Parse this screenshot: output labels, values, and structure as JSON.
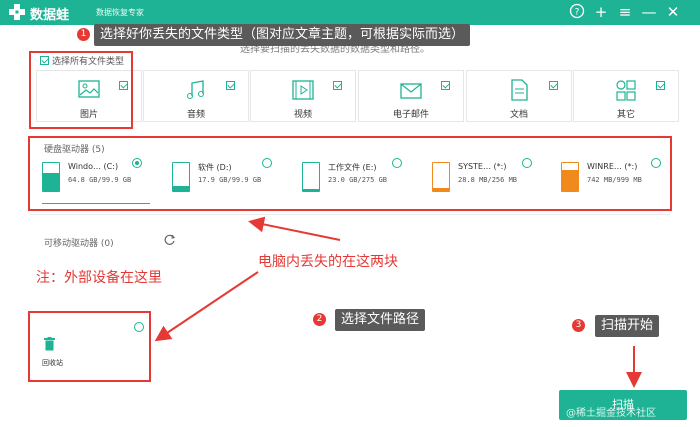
{
  "app": {
    "name": "数据蛙",
    "subtitle": "数据恢复专家"
  },
  "window_controls": {
    "help": "?",
    "add": "+",
    "menu": "≡",
    "minimize": "—",
    "close": "✕"
  },
  "callouts": {
    "step1": {
      "num": "1",
      "text": "选择好你丢失的文件类型（图对应文章主题，可根据实际而选）"
    },
    "step2": {
      "num": "2",
      "text": "选择文件路径"
    },
    "step3": {
      "num": "3",
      "text": "扫描开始"
    }
  },
  "file_types": {
    "header_faded": "选择要扫描的丢失数据的数据类型和路径。",
    "select_all": "选择所有文件类型",
    "items": [
      {
        "label": "图片",
        "icon": "image-icon"
      },
      {
        "label": "音频",
        "icon": "music-icon"
      },
      {
        "label": "视频",
        "icon": "video-icon"
      },
      {
        "label": "电子邮件",
        "icon": "email-icon"
      },
      {
        "label": "文档",
        "icon": "document-icon"
      },
      {
        "label": "其它",
        "icon": "other-icon"
      }
    ]
  },
  "hard_drives": {
    "label": "硬盘驱动器 (5)",
    "items": [
      {
        "name": "Windo… (C:)",
        "size": "64.8 GB/99.9 GB",
        "used": 0.65,
        "color": "#1db394",
        "selected": true
      },
      {
        "name": "软件 (D:)",
        "size": "17.9 GB/99.9 GB",
        "used": 0.18,
        "color": "#1db394",
        "selected": false
      },
      {
        "name": "工作文件 (E:)",
        "size": "23.0 GB/275 GB",
        "used": 0.08,
        "color": "#1db394",
        "selected": false
      },
      {
        "name": "SYSTE… (*:)",
        "size": "28.8 MB/256 MB",
        "used": 0.11,
        "color": "#f08a1c",
        "selected": false
      },
      {
        "name": "WINRE… (*:)",
        "size": "742 MB/999 MB",
        "used": 0.74,
        "color": "#f08a1c",
        "selected": false
      }
    ]
  },
  "removable": {
    "label": "可移动驱动器 (0)"
  },
  "annotations": {
    "drives_note": "电脑内丢失的在这两块",
    "external_note": "注：外部设备在这里"
  },
  "recycle_bin": {
    "label": "回收站"
  },
  "scan_button": {
    "label": "扫描"
  },
  "watermark": "@稀土掘金技术社区",
  "colors": {
    "accent": "#1db394",
    "annotation": "#e53935",
    "banner": "#5a5a5a"
  }
}
